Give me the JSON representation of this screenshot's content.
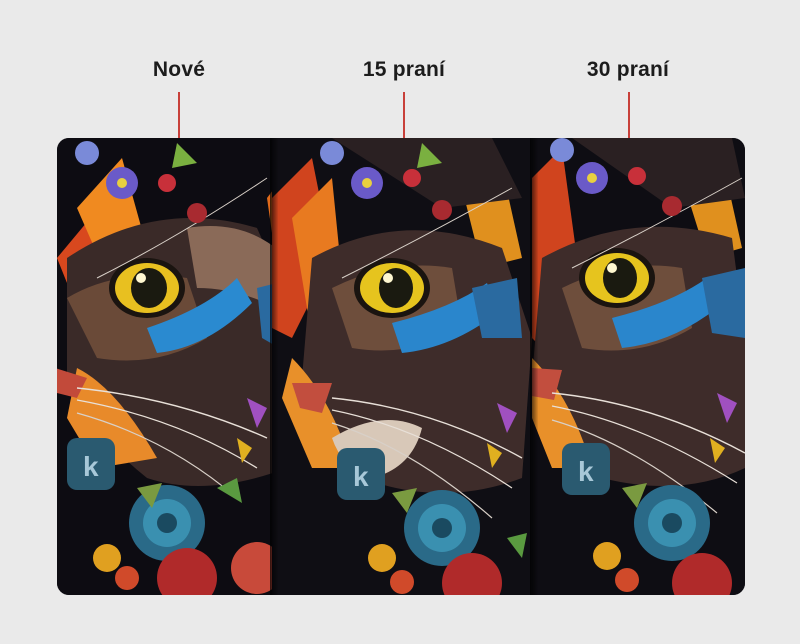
{
  "labels": {
    "new": "Nové",
    "wash15": "15 praní",
    "wash30": "30 praní"
  },
  "accent_color": "#c8403a",
  "image_description_colors": {
    "background": "#eaeaea",
    "fabric_dark": "#0c0b10"
  }
}
